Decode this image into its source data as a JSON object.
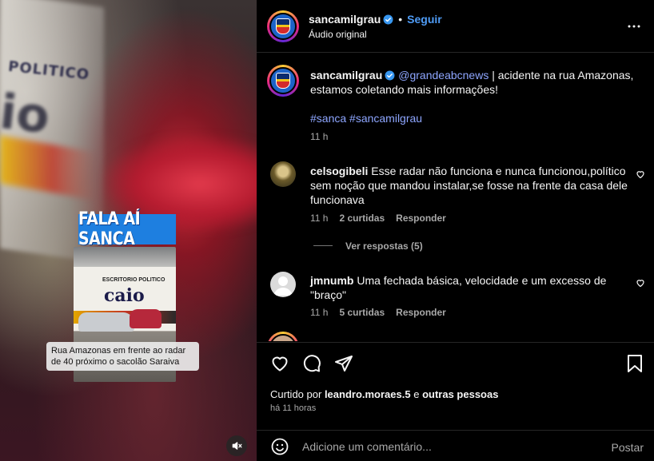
{
  "video": {
    "banner_text": "FALA AÍ SANCA",
    "caption": "Rua Amazonas em frente ao radar de 40 próximo o sacolão Saraiva",
    "wall_text": "POLITICO",
    "thumb_wall_text": "ESCRITORIO POLITICO",
    "thumb_big_text": "caio",
    "mute_icon": "speaker-muted-icon"
  },
  "header": {
    "username": "sancamilgrau",
    "separator": "•",
    "follow_label": "Seguir",
    "audio_label": "Áudio original",
    "more_icon": "more-options-icon"
  },
  "post": {
    "username": "sancamilgrau",
    "mention": "@grandeabcnews",
    "caption_text": " | acidente na rua Amazonas, estamos coletando mais informações!",
    "hashtags": "#sanca #sancamilgrau",
    "time": "11 h"
  },
  "comments": [
    {
      "username": "celsogibeli",
      "text": "Esse radar não funciona e nunca funcionou,político sem noção que mandou instalar,se fosse na frente da casa dele funcionava",
      "time": "11 h",
      "likes": "2 curtidas",
      "reply_label": "Responder",
      "view_replies": "Ver respostas (5)"
    },
    {
      "username": "jmnumb",
      "text": "Uma fechada básica, velocidade e um excesso de \"braço\"",
      "time": "11 h",
      "likes": "5 curtidas",
      "reply_label": "Responder"
    }
  ],
  "actions": {
    "liked_by_prefix": "Curtido por",
    "liked_by_user": "leandro.moraes.5",
    "liked_by_conj": "e",
    "liked_by_others": "outras pessoas",
    "timestamp": "há 11 horas"
  },
  "comment_box": {
    "placeholder": "Adicione um comentário...",
    "post_label": "Postar"
  },
  "colors": {
    "accent": "#4f9cf6",
    "link": "#8ea6ff",
    "muted": "#a8a8a8",
    "banner": "#1e7fe0"
  }
}
